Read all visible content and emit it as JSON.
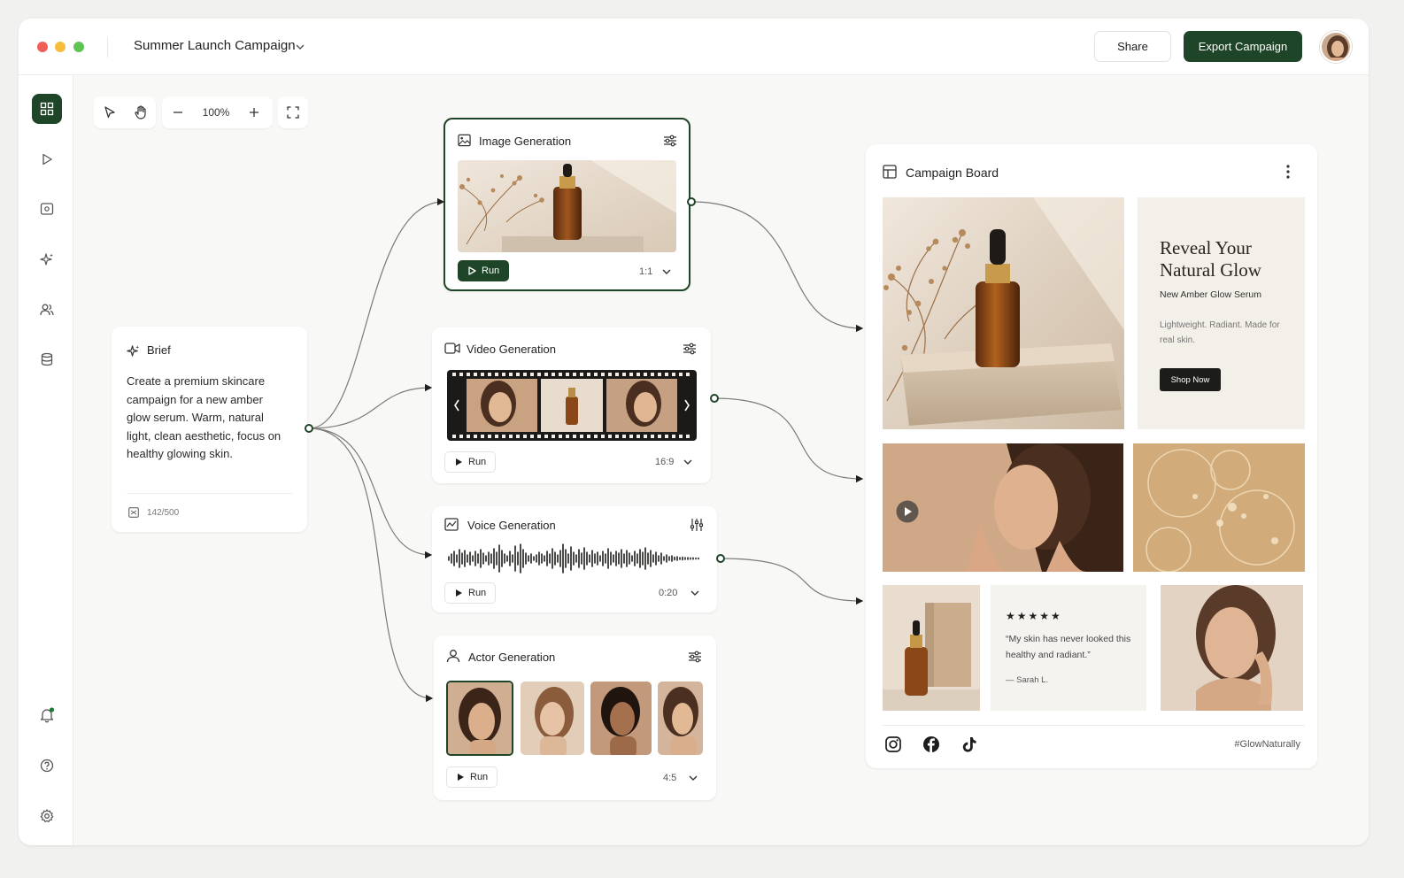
{
  "window": {
    "title": "Summer Launch Campaign",
    "share_label": "Share",
    "export_label": "Export Campaign",
    "traffic_lights": [
      "#ef5f57",
      "#f6bd3b",
      "#5fc454"
    ],
    "accent": "#1f4528"
  },
  "toolbar": {
    "zoom": "100%"
  },
  "brief": {
    "title": "Brief",
    "text": "Create a premium skincare campaign for a new amber glow serum. Warm, natural light, clean aesthetic, focus on healthy glowing skin.",
    "count": "142/500"
  },
  "nodes": {
    "image": {
      "title": "Image Generation",
      "run_label": "Run",
      "ratio": "1:1"
    },
    "video": {
      "title": "Video Generation",
      "run_label": "Run",
      "ratio": "16:9"
    },
    "voice": {
      "title": "Voice Generation",
      "run_label": "Run",
      "duration": "0:20"
    },
    "actor": {
      "title": "Actor Generation",
      "run_label": "Run",
      "ratio": "4:5"
    }
  },
  "board": {
    "title": "Campaign Board",
    "hero_heading": "Reveal Your Natural Glow",
    "hero_subtitle": "New Amber Glow Serum",
    "hero_description": "Lightweight. Radiant. Made for real skin.",
    "shop_label": "Shop Now",
    "review_stars": "★★★★★",
    "review_quote": "“My skin has never looked this healthy and radiant.”",
    "review_author": "— Sarah L.",
    "hashtag": "#GlowNaturally",
    "social_icons": [
      "instagram-icon",
      "facebook-icon",
      "tiktok-icon"
    ]
  }
}
